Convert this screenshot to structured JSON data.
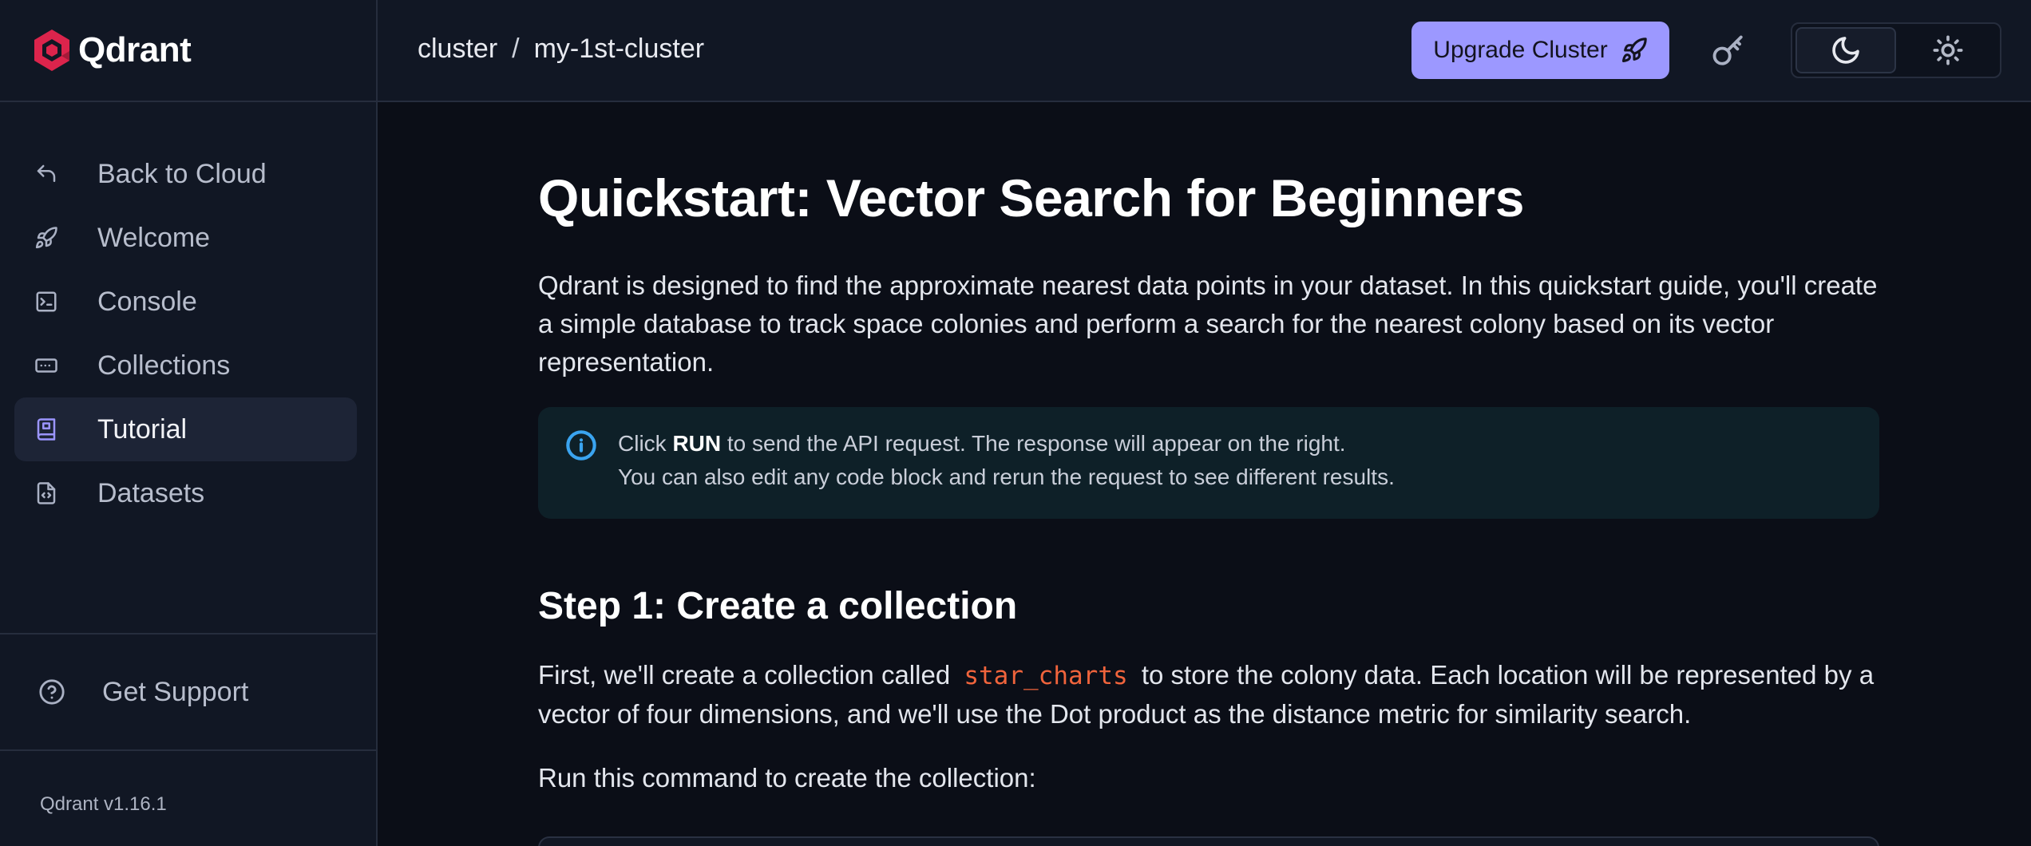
{
  "brand": {
    "name": "Qdrant"
  },
  "header": {
    "breadcrumb": {
      "root": "cluster",
      "separator": "/",
      "current": "my-1st-cluster"
    },
    "upgrade_label": "Upgrade Cluster"
  },
  "sidebar": {
    "items": [
      {
        "label": "Back to Cloud",
        "icon": "back-arrow-icon"
      },
      {
        "label": "Welcome",
        "icon": "rocket-icon"
      },
      {
        "label": "Console",
        "icon": "terminal-icon"
      },
      {
        "label": "Collections",
        "icon": "collection-icon"
      },
      {
        "label": "Tutorial",
        "icon": "book-icon",
        "active": true
      },
      {
        "label": "Datasets",
        "icon": "file-code-icon"
      }
    ],
    "support_label": "Get Support",
    "version": "Qdrant v1.16.1"
  },
  "main": {
    "title": "Quickstart: Vector Search for Beginners",
    "intro": "Qdrant is designed to find the approximate nearest data points in your dataset. In this quickstart guide, you'll create a simple database to track space colonies and perform a search for the nearest colony based on its vector representation.",
    "info": {
      "prefix": "Click",
      "bold": "RUN",
      "suffix": "to send the API request. The response will appear on the right.",
      "line2": "You can also edit any code block and rerun the request to see different results."
    },
    "step1": {
      "heading": "Step 1: Create a collection",
      "text_before": "First, we'll create a collection called",
      "code": "star_charts",
      "text_after": "to store the colony data. Each location will be represented by a vector of four dimensions, and we'll use the Dot product as the distance metric for similarity search.",
      "run_text": "Run this command to create the collection:"
    }
  },
  "colors": {
    "accent": "#9c98ff",
    "background": "#0b0e17",
    "sidebar": "#111724",
    "info_icon": "#3aa4f0",
    "code_inline": "#f0643c"
  }
}
